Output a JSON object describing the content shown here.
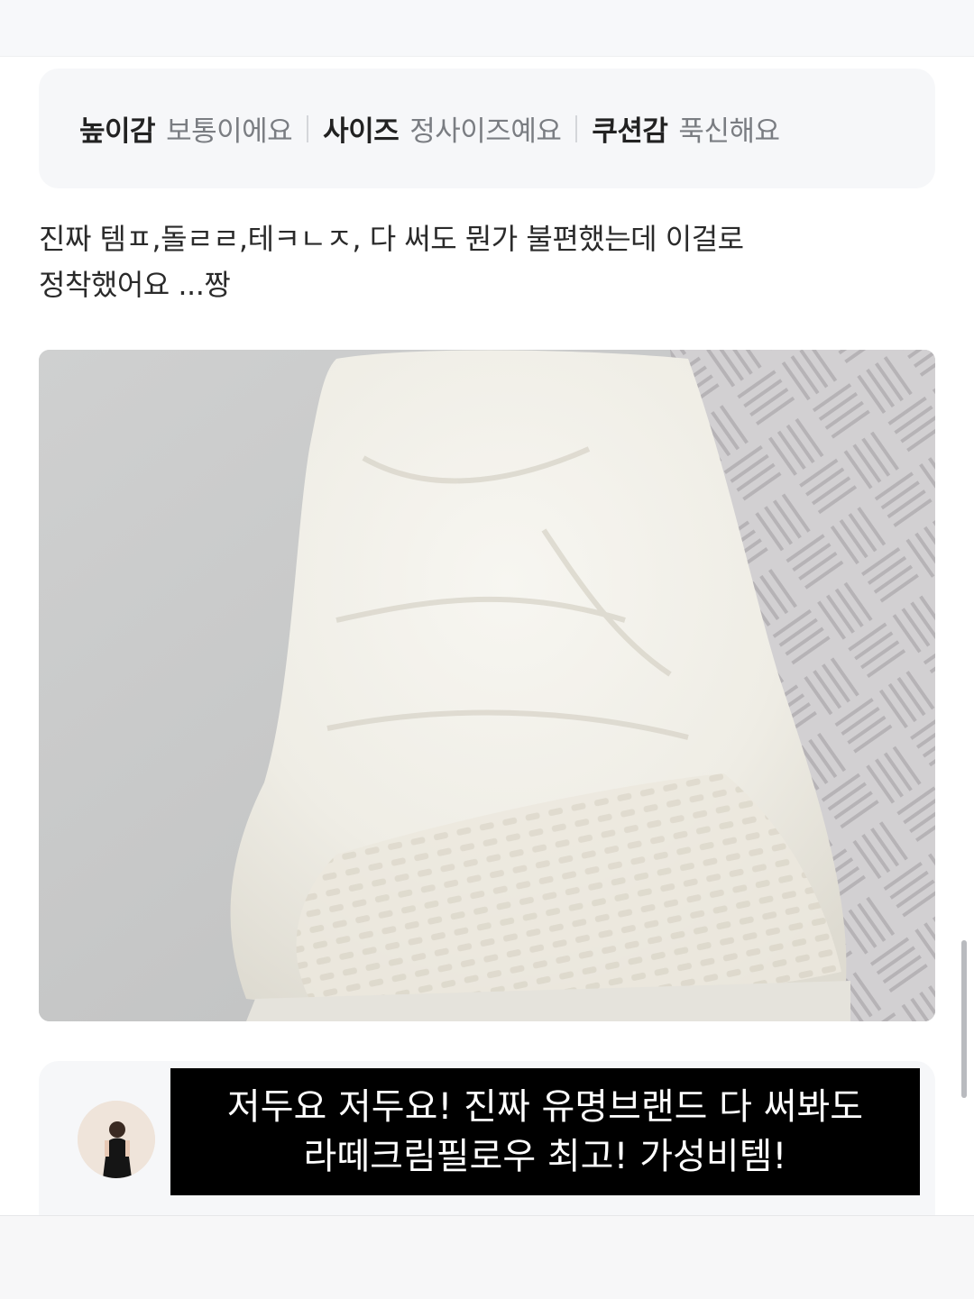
{
  "rating": {
    "items": [
      {
        "label": "높이감",
        "value": "보통이에요"
      },
      {
        "label": "사이즈",
        "value": "정사이즈예요"
      },
      {
        "label": "쿠션감",
        "value": "푹신해요"
      }
    ]
  },
  "review": {
    "lines": [
      "진짜 템ㅍ,돌ㄹㄹ,테ㅋㄴㅈ, 다 써도 뭔가 불편했는데 이걸로",
      "정착했어요 ...짱"
    ]
  },
  "reply": {
    "caption_lines": [
      "저두요 저두요! 진짜 유명브랜드 다 써봐도",
      "라떼크림필로우 최고! 가성비템!"
    ]
  },
  "colors": {
    "card_background": "#f6f7f9",
    "caption_background": "#000000",
    "caption_text": "#ffffff"
  }
}
